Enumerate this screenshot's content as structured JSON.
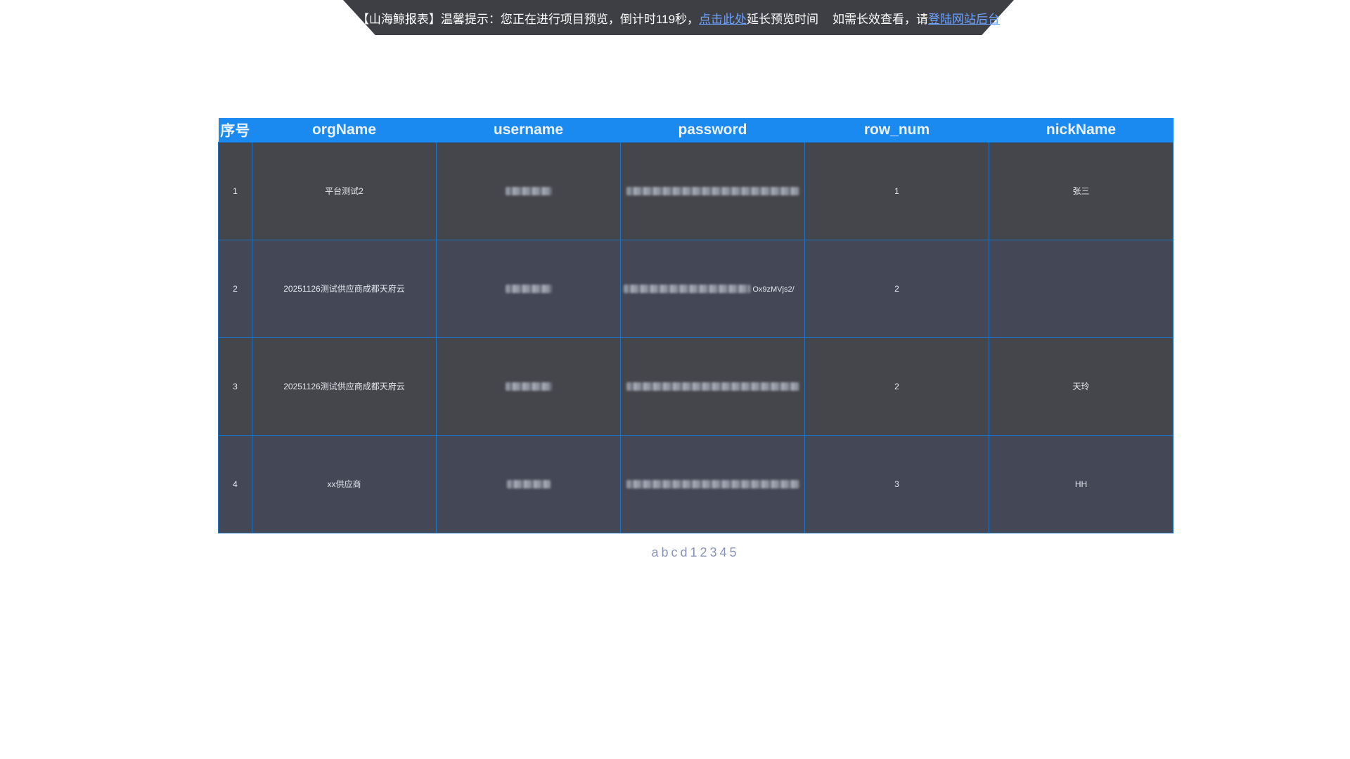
{
  "banner": {
    "prefix": "【山海鲸报表】温馨提示：您正在进行项目预览，倒计时119秒，",
    "extend_link": "点击此处",
    "middle": "延长预览时间",
    "long_view": "如需长效查看，请",
    "login_link": "登陆网站后台"
  },
  "table": {
    "headers": [
      "序号",
      "orgName",
      "username",
      "password",
      "row_num",
      "nickName"
    ],
    "rows": [
      {
        "index": "1",
        "orgName": "平台测试2",
        "password_tail": "",
        "row_num": "1",
        "nickName": "张三"
      },
      {
        "index": "2",
        "orgName": "20251126测试供应商成都天府云",
        "password_tail": "Ox9zMVjs2/",
        "row_num": "2",
        "nickName": ""
      },
      {
        "index": "3",
        "orgName": "20251126测试供应商成都天府云",
        "password_tail": "",
        "row_num": "2",
        "nickName": "天玲"
      },
      {
        "index": "4",
        "orgName": "xx供应商",
        "password_tail": "",
        "row_num": "3",
        "nickName": "HH"
      }
    ]
  },
  "footer": {
    "pager_text": "abcd12345"
  }
}
